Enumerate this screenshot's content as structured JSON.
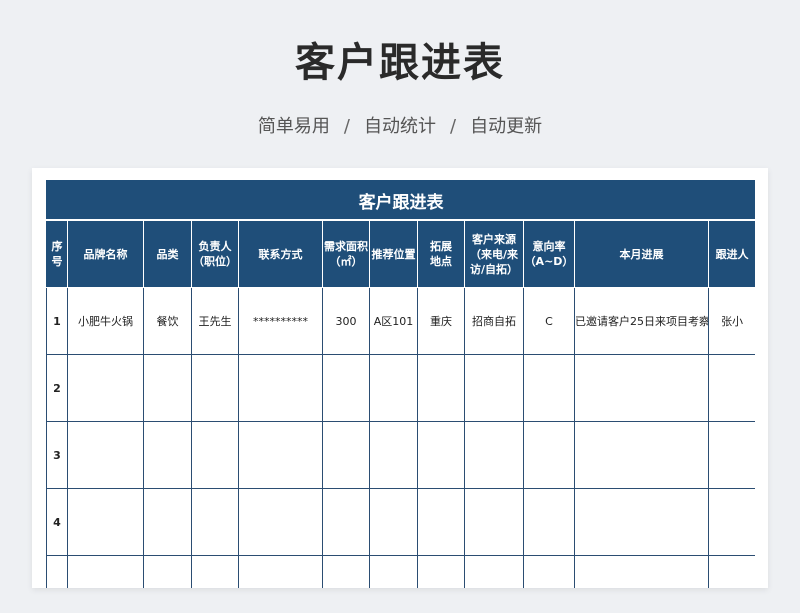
{
  "header": {
    "title": "客户跟进表",
    "tags": [
      "简单易用",
      "自动统计",
      "自动更新"
    ],
    "separator": "/"
  },
  "sheet": {
    "title": "客户跟进表",
    "columns": [
      "序号",
      "品牌名称",
      "品类",
      "负责人\n（职位）",
      "联系方式",
      "需求面积\n（㎡）",
      "推荐位置",
      "拓展\n地点",
      "客户来源\n（来电/来\n访/自拓）",
      "意向率\n（A~D）",
      "本月进展",
      "跟进人"
    ],
    "rows": [
      [
        "1",
        "小肥牛火锅",
        "餐饮",
        "王先生",
        "**********",
        "300",
        "A区101",
        "重庆",
        "招商自拓",
        "C",
        "已邀请客户25日来项目考察",
        "张小"
      ],
      [
        "2",
        "",
        "",
        "",
        "",
        "",
        "",
        "",
        "",
        "",
        "",
        ""
      ],
      [
        "3",
        "",
        "",
        "",
        "",
        "",
        "",
        "",
        "",
        "",
        "",
        ""
      ],
      [
        "4",
        "",
        "",
        "",
        "",
        "",
        "",
        "",
        "",
        "",
        "",
        ""
      ],
      [
        "",
        "",
        "",
        "",
        "",
        "",
        "",
        "",
        "",
        "",
        "",
        ""
      ]
    ]
  }
}
